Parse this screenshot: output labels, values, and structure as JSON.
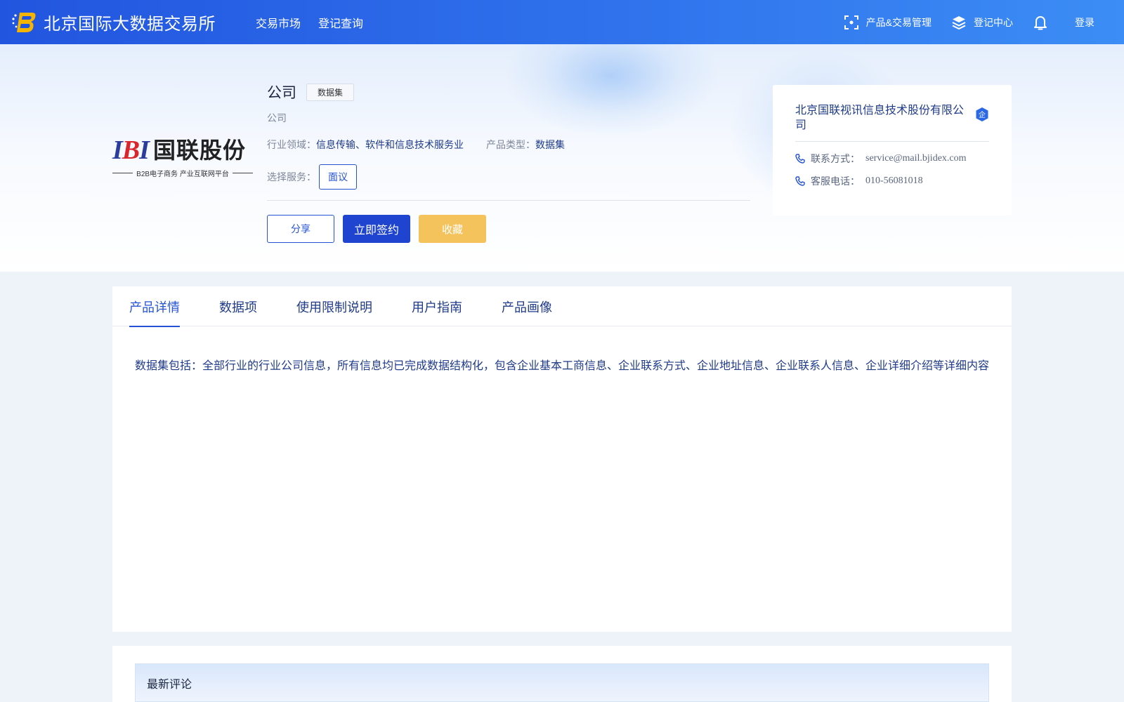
{
  "header": {
    "brand": "北京国际大数据交易所",
    "nav": [
      "交易市场",
      "登记查询"
    ],
    "product_mgmt": "产品&交易管理",
    "register_center": "登记中心",
    "login": "登录"
  },
  "product": {
    "logo_text": "国联股份",
    "logo_letters": "IBI",
    "logo_sub": "B2B电子商务 产业互联网平台",
    "title": "公司",
    "tag": "数据集",
    "subtitle": "公司",
    "industry_label": "行业领域：",
    "industry_value": "信息传输、软件和信息技术服务业",
    "type_label": "产品类型：",
    "type_value": "数据集",
    "service_label": "选择服务：",
    "service_option": "面议",
    "buttons": {
      "share": "分享",
      "sign": "立即签约",
      "favorite": "收藏"
    }
  },
  "seller": {
    "name": "北京国联视讯信息技术股份有限公司",
    "badge": "企",
    "contact_label": "联系方式：",
    "contact_value": "service@mail.bjidex.com",
    "phone_label": "客服电话：",
    "phone_value": "010-56081018"
  },
  "tabs": [
    "产品详情",
    "数据项",
    "使用限制说明",
    "用户指南",
    "产品画像"
  ],
  "active_tab": 0,
  "description": "数据集包括：全部行业的行业公司信息，所有信息均已完成数据结构化，包含企业基本工商信息、企业联系方式、企业地址信息、企业联系人信息、企业详细介绍等详细内容",
  "comments": {
    "title": "最新评论"
  },
  "colors": {
    "primary": "#1e44d0",
    "accent_yellow": "#f5c35c",
    "text_blue": "#1f3b8a"
  }
}
